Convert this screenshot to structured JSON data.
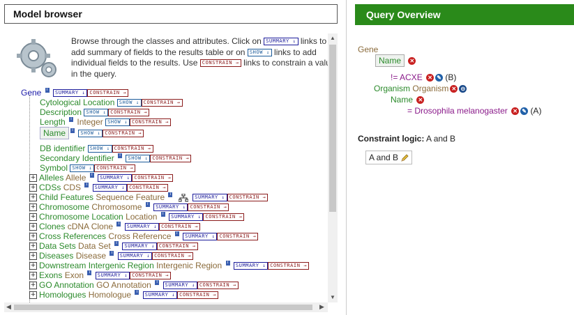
{
  "model_browser": {
    "title": "Model browser",
    "intro_text": "Browse through the classes and attributes. Click on SUMMARY ↓ links to add summary of fields to the results table or on SHOW ↓ links to add individual fields to the results. Use CONSTRAIN → links to constrain a value in the query.",
    "intro_parts": {
      "p1": "Browse through the classes and attributes. Click on",
      "p2": "links to add summary of fields to the results table or on",
      "p3": "links to add individual fields to the results. Use",
      "p4": "links to constrain a value in the query."
    },
    "buttons": {
      "summary": "SUMMARY ↓",
      "show": "SHOW ↓",
      "constrain": "CONSTRAIN →"
    },
    "root": {
      "name": "Gene"
    },
    "attributes": [
      {
        "name": "Cytological Location",
        "type": ""
      },
      {
        "name": "Description",
        "type": ""
      },
      {
        "name": "Length",
        "type": "Integer"
      },
      {
        "name": "Name",
        "type": ""
      },
      {
        "name": "DB identifier",
        "type": ""
      },
      {
        "name": "Secondary Identifier",
        "type": ""
      },
      {
        "name": "Symbol",
        "type": ""
      }
    ],
    "references": [
      {
        "name": "Alleles",
        "type": "Allele"
      },
      {
        "name": "CDSs",
        "type": "CDS"
      },
      {
        "name": "Child Features",
        "type": "Sequence Feature"
      },
      {
        "name": "Chromosome",
        "type": "Chromosome"
      },
      {
        "name": "Chromosome Location",
        "type": "Location"
      },
      {
        "name": "Clones",
        "type": "cDNA Clone"
      },
      {
        "name": "Cross References",
        "type": "Cross Reference"
      },
      {
        "name": "Data Sets",
        "type": "Data Set"
      },
      {
        "name": "Diseases",
        "type": "Disease"
      },
      {
        "name": "Downstream Intergenic Region",
        "type": "Intergenic Region"
      },
      {
        "name": "Exons",
        "type": "Exon"
      },
      {
        "name": "GO Annotation",
        "type": "GO Annotation"
      },
      {
        "name": "Homologues",
        "type": "Homologue"
      }
    ]
  },
  "query_overview": {
    "title": "Query Overview",
    "root": "Gene",
    "name_node": "Name",
    "constraint1": "!= ACXE",
    "constraint1_code": "(B)",
    "organism_label": "Organism",
    "organism_type": "Organism",
    "organism_name": "Name",
    "constraint2": "= Drosophila melanogaster",
    "constraint2_code": "(A)",
    "logic_label": "Constraint logic:",
    "logic_value": "A and B",
    "logic_box": "A and B"
  },
  "colors": {
    "header_green": "#2a8a1a",
    "field_green": "#2b8a2b",
    "type_brown": "#8a6a3a",
    "class_blue": "#1a1aa8",
    "remove_red": "#c82020"
  }
}
